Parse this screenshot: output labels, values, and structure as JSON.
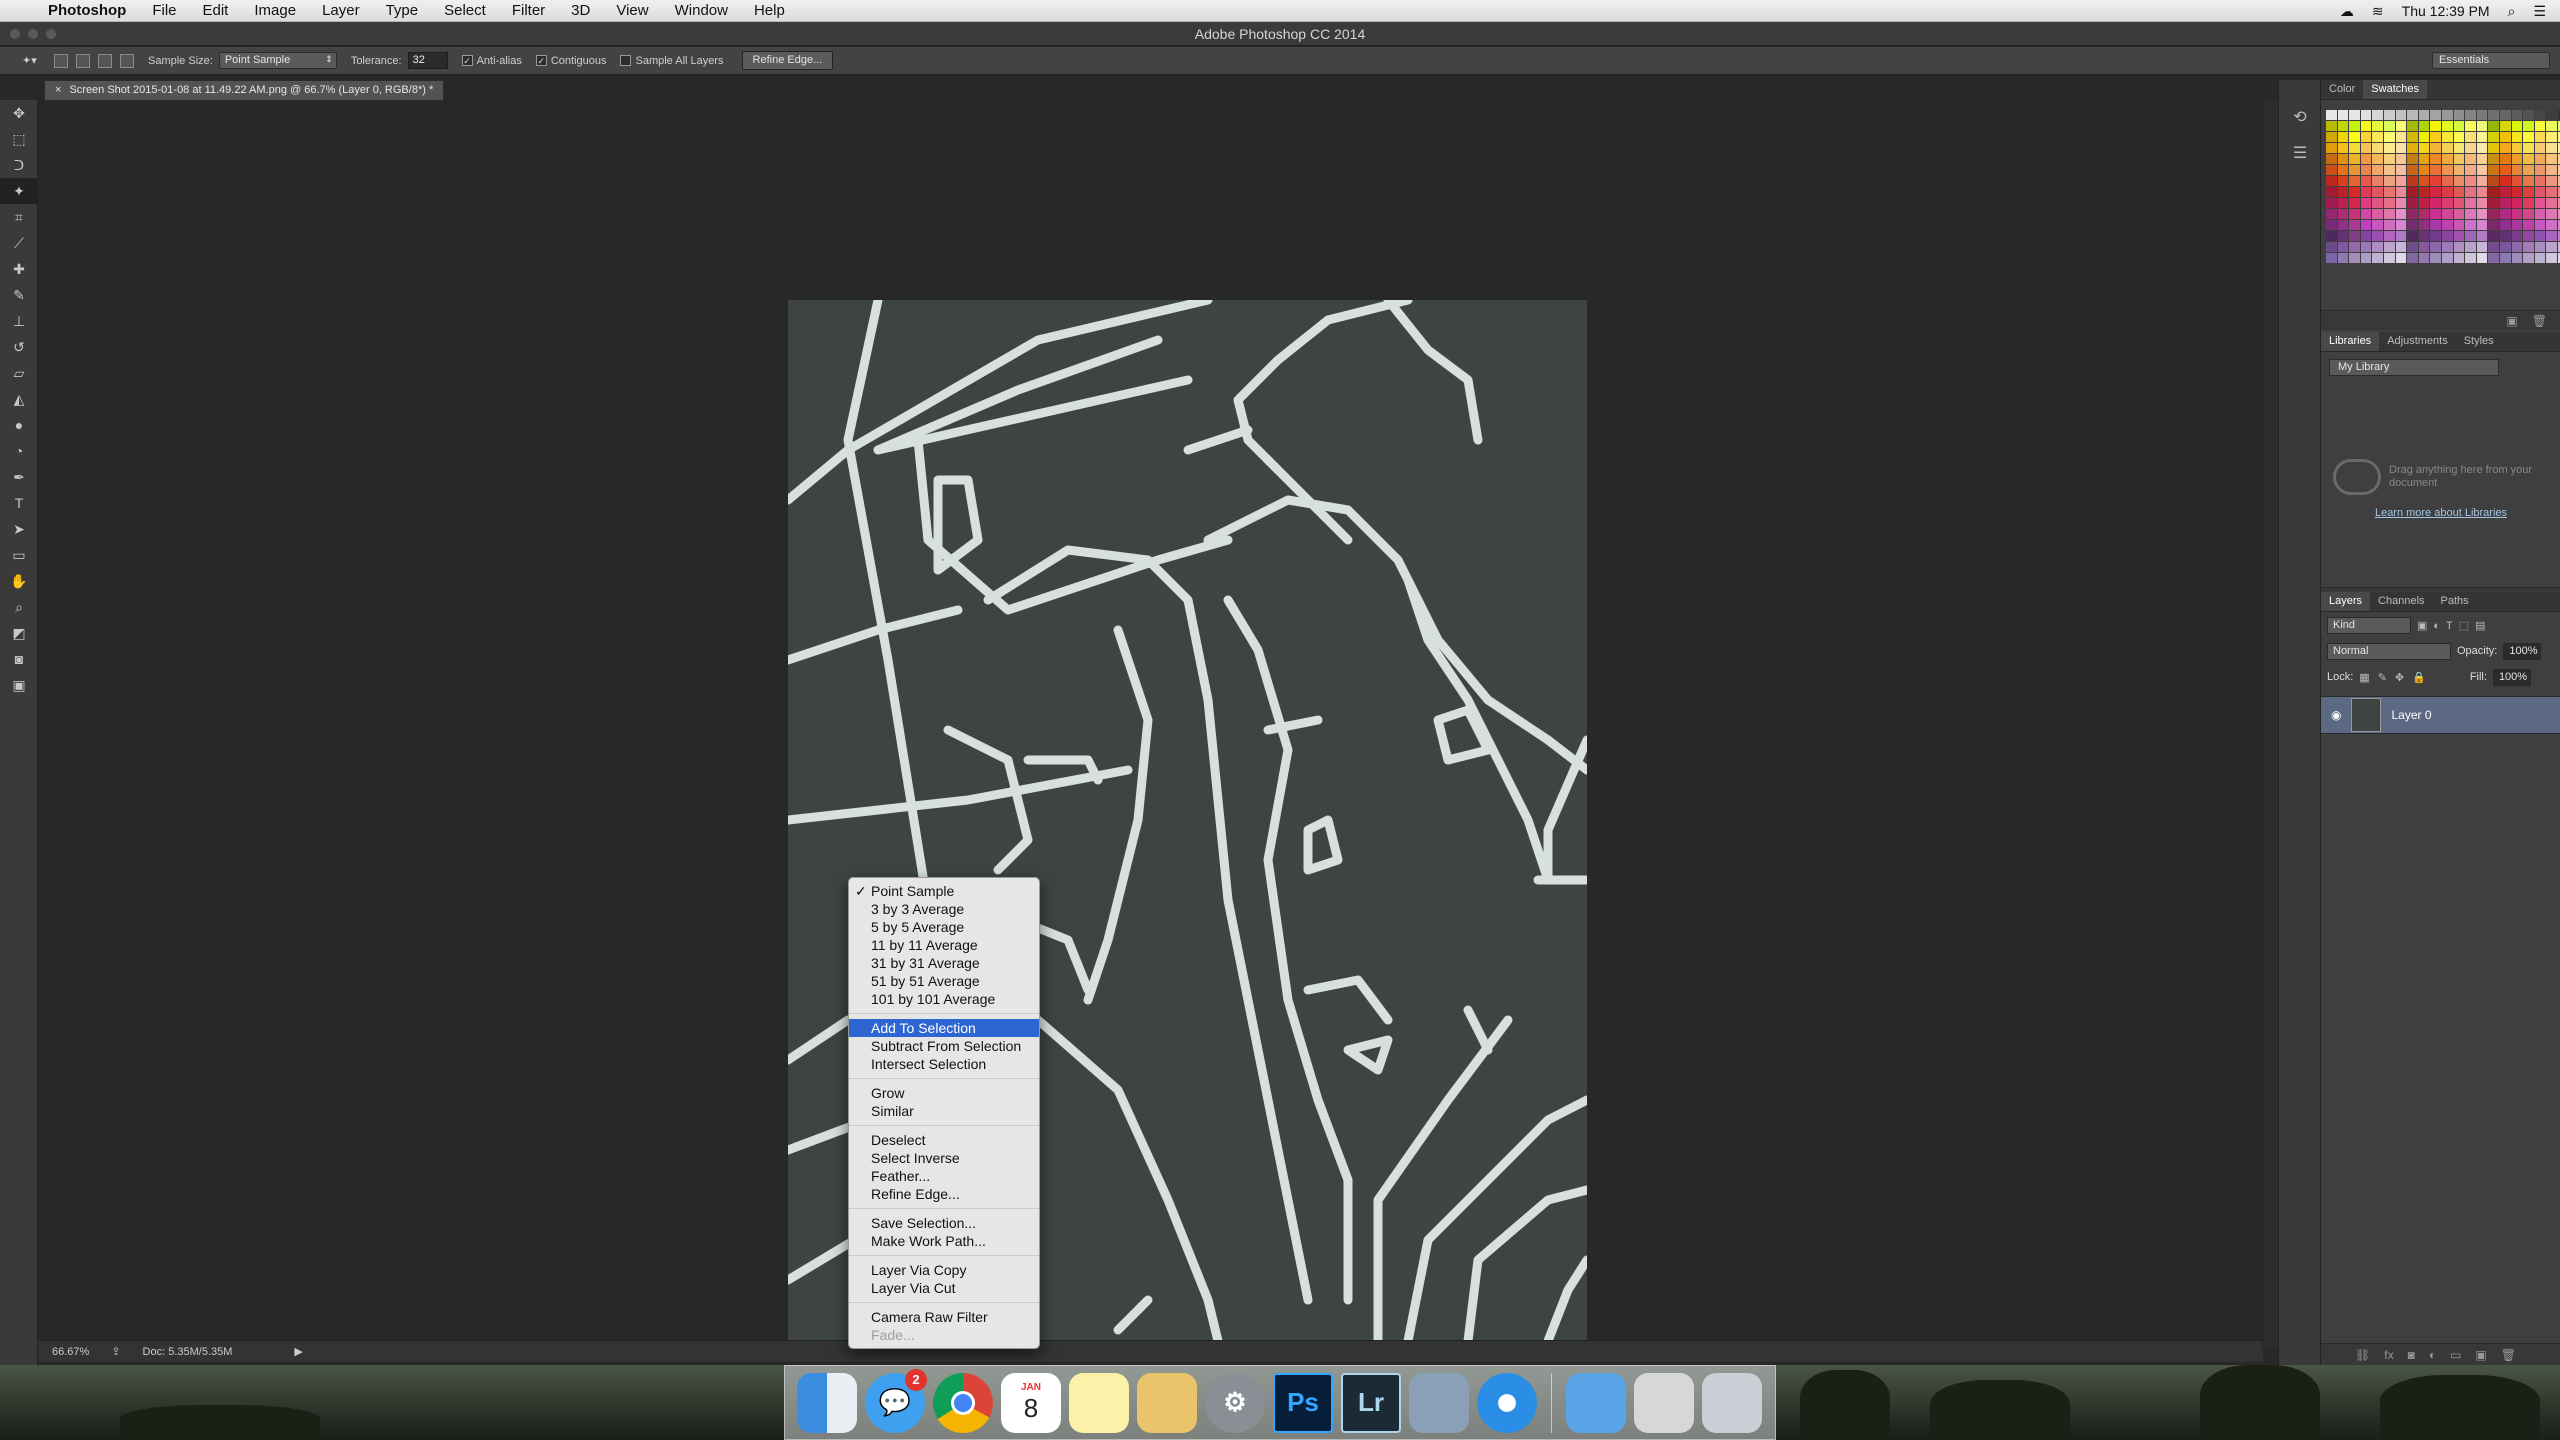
{
  "menubar": {
    "app": "Photoshop",
    "menus": [
      "File",
      "Edit",
      "Image",
      "Layer",
      "Type",
      "Select",
      "Filter",
      "3D",
      "View",
      "Window",
      "Help"
    ],
    "clock": "Thu 12:39 PM"
  },
  "window": {
    "title": "Adobe Photoshop CC 2014"
  },
  "options": {
    "sample_size_label": "Sample Size:",
    "sample_size_value": "Point Sample",
    "tolerance_label": "Tolerance:",
    "tolerance_value": "32",
    "anti_alias": "Anti-alias",
    "contiguous": "Contiguous",
    "sample_all_layers": "Sample All Layers",
    "refine_edge": "Refine Edge...",
    "workspace": "Essentials"
  },
  "document": {
    "tab_title": "Screen Shot 2015-01-08 at 11.49.22 AM.png @ 66.7% (Layer 0, RGB/8*) *",
    "close": "×"
  },
  "status": {
    "zoom": "66.67%",
    "doc": "Doc: 5.35M/5.35M"
  },
  "panels": {
    "color_tabs": [
      "Color",
      "Swatches"
    ],
    "lib_tabs": [
      "Libraries",
      "Adjustments",
      "Styles"
    ],
    "library_name": "My Library",
    "library_message": "Drag anything here from your document",
    "library_link": "Learn more about Libraries",
    "layer_tabs": [
      "Layers",
      "Channels",
      "Paths"
    ],
    "kind": "Kind",
    "blend": "Normal",
    "opacity_label": "Opacity:",
    "opacity": "100%",
    "lock_label": "Lock:",
    "fill_label": "Fill:",
    "fill": "100%",
    "layer_name": "Layer 0"
  },
  "context_menu": {
    "items": [
      {
        "label": "Point Sample",
        "checked": true
      },
      {
        "label": "3 by 3 Average"
      },
      {
        "label": "5 by 5 Average"
      },
      {
        "label": "11 by 11 Average"
      },
      {
        "label": "31 by 31 Average"
      },
      {
        "label": "51 by 51 Average"
      },
      {
        "label": "101 by 101 Average"
      },
      {
        "sep": true
      },
      {
        "label": "Add To Selection",
        "selected": true
      },
      {
        "label": "Subtract From Selection"
      },
      {
        "label": "Intersect Selection"
      },
      {
        "sep": true
      },
      {
        "label": "Grow"
      },
      {
        "label": "Similar"
      },
      {
        "sep": true
      },
      {
        "label": "Deselect"
      },
      {
        "label": "Select Inverse"
      },
      {
        "label": "Feather..."
      },
      {
        "label": "Refine Edge..."
      },
      {
        "sep": true
      },
      {
        "label": "Save Selection..."
      },
      {
        "label": "Make Work Path..."
      },
      {
        "sep": true
      },
      {
        "label": "Layer Via Copy"
      },
      {
        "label": "Layer Via Cut"
      },
      {
        "sep": true
      },
      {
        "label": "Camera Raw Filter"
      },
      {
        "label": "Fade...",
        "disabled": true
      }
    ]
  },
  "dock": {
    "calendar_month": "JAN",
    "calendar_day": "8",
    "messages_badge": "2",
    "ps_label": "Ps",
    "lr_label": "Lr"
  },
  "colors": {
    "canvas_bg": "#3d4442",
    "road": "#d8e0dc",
    "selection_blue": "#2d66d2"
  }
}
